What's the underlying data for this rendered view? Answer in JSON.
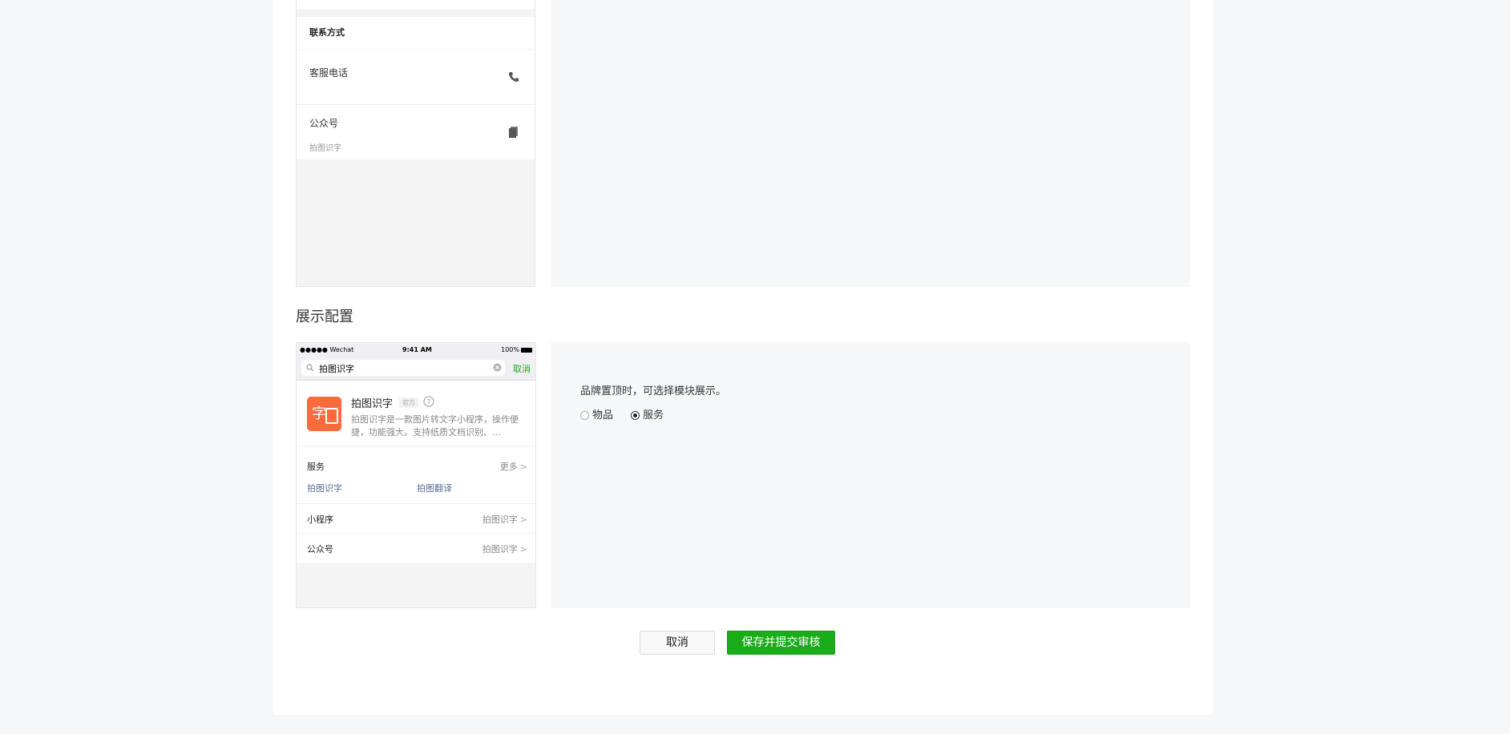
{
  "contact_preview": {
    "header": "联系方式",
    "phone_label": "客服电话",
    "official_label": "公众号",
    "official_sub": "拍图识字",
    "phone_icon": "phone-icon",
    "official_icon": "document-icon"
  },
  "display_config": {
    "title": "展示配置",
    "preview": {
      "status_left": "●●●●● Wechat",
      "status_time": "9:41 AM",
      "status_battery": "100%",
      "search_query": "拍图识字",
      "search_cancel": "取消",
      "app_name": "拍图识字",
      "app_badge": "官方",
      "logo_char": "字",
      "app_desc": "拍图识字是一款图片转文字小程序，操作便捷，功能强大。支持纸质文档识别、...",
      "services_title": "服务",
      "services_more": "更多",
      "services": [
        "拍图识字",
        "拍图翻译"
      ],
      "rows": [
        {
          "label": "小程序",
          "value": "拍图识字"
        },
        {
          "label": "公众号",
          "value": "拍图识字"
        }
      ]
    },
    "description": "品牌置顶时，可选择模块展示。",
    "options": [
      {
        "label": "物品",
        "checked": false
      },
      {
        "label": "服务",
        "checked": true
      }
    ]
  },
  "actions": {
    "cancel_label": "取消",
    "submit_label": "保存并提交审核"
  },
  "colors": {
    "accent": "#1aad19",
    "link": "#576b95",
    "logo": "#fa6a3c",
    "page_bg": "#f6f7f9"
  }
}
